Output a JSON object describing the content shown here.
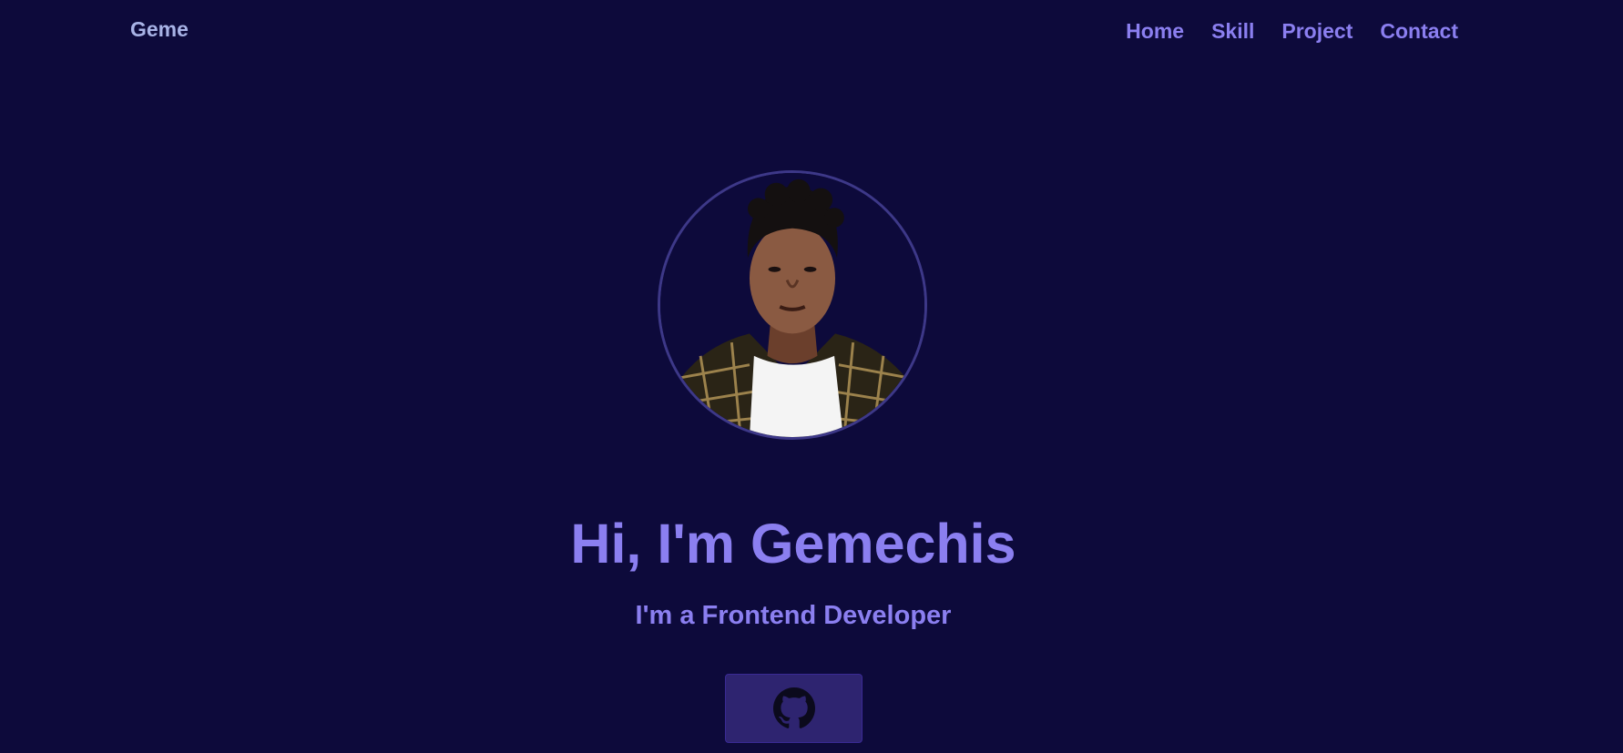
{
  "colors": {
    "background": "#0d0a3b",
    "accent": "#8b7ff0",
    "brand_text": "#a8b3e6",
    "button_bg": "#2e2470",
    "icon": "#0b0a1c"
  },
  "header": {
    "brand": "Geme",
    "nav": [
      {
        "label": "Home"
      },
      {
        "label": "Skill"
      },
      {
        "label": "Project"
      },
      {
        "label": "Contact"
      }
    ]
  },
  "hero": {
    "avatar_alt": "profile photo",
    "title": "Hi, I'm Gemechis",
    "subtitle": "I'm a Frontend Developer",
    "social": [
      {
        "icon": "github-icon"
      }
    ]
  }
}
